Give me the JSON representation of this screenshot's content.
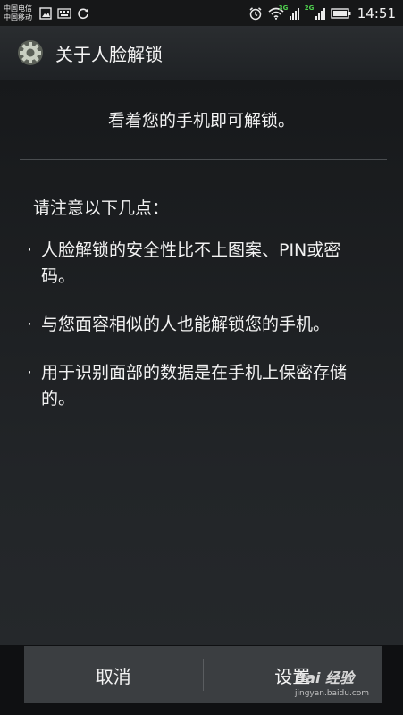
{
  "status_bar": {
    "carrier1": "中国电信",
    "carrier2": "中国移动",
    "net_type_1": "3G",
    "net_type_2": "2G",
    "time": "14:51"
  },
  "title_bar": {
    "title": "关于人脸解锁",
    "icon": "gear-icon"
  },
  "content": {
    "headline": "看着您的手机即可解锁。",
    "intro": "请注意以下几点：",
    "points": [
      "人脸解锁的安全性比不上图案、PIN或密码。",
      "与您面容相似的人也能解锁您的手机。",
      "用于识别面部的数据是在手机上保密存储的。"
    ]
  },
  "buttons": {
    "cancel": "取消",
    "settings": "设置"
  },
  "watermark": {
    "logo": "Bai 经验",
    "url": "jingyan.baidu.com"
  }
}
